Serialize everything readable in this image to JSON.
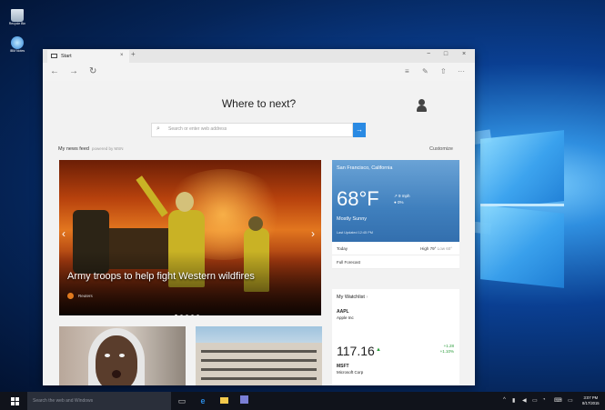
{
  "desktop": {
    "icons": [
      {
        "label": "Recycle Bin",
        "icon": "recycle-bin-icon"
      },
      {
        "label": "IBM Notes",
        "icon": "notes-app-icon"
      }
    ]
  },
  "browser": {
    "tab_title": "Start",
    "new_tab": "+",
    "window_controls": {
      "minimize": "−",
      "maximize": "□",
      "close": "×"
    },
    "nav": {
      "back": "←",
      "forward": "→",
      "refresh": "↻"
    },
    "toolbar": {
      "hub": "≡",
      "note": "✎",
      "share": "⇧",
      "more": "···"
    }
  },
  "start_page": {
    "heading": "Where to next?",
    "search_placeholder": "Search or enter web address",
    "search_go": "→",
    "feed_label": "My news feed",
    "feed_powered": "powered by MSN",
    "customize": "Customize"
  },
  "hero": {
    "headline": "Army troops to help fight Western wildfires",
    "source": "Reuters",
    "prev": "‹",
    "next": "›",
    "slide_count": 5,
    "active_slide": 0
  },
  "weather": {
    "city": "San Francisco, California",
    "temp": "68°F",
    "wind": "9 mph",
    "precip": "0%",
    "condition": "Mostly Sunny",
    "updated": "Last Updated 12:45 PM",
    "today_label": "Today",
    "high": "High 79°",
    "low": "Low 60°",
    "full_forecast": "Full Forecast"
  },
  "watchlist": {
    "title": "My Watchlist",
    "stocks": [
      {
        "symbol": "AAPL",
        "name": "Apple Inc"
      },
      {
        "symbol": "MSFT",
        "name": "Microsoft Corp"
      }
    ],
    "price": "117.16",
    "arrow": "▲",
    "change": "+1.28",
    "change_pct": "+1.10%"
  },
  "taskbar": {
    "search_placeholder": "Search the web and Windows",
    "clock_time": "3:07 PM",
    "clock_date": "8/17/2015"
  },
  "colors": {
    "accent": "#2a8ae3",
    "stock_up": "#2b9c3b",
    "taskbar": "#10131b"
  }
}
